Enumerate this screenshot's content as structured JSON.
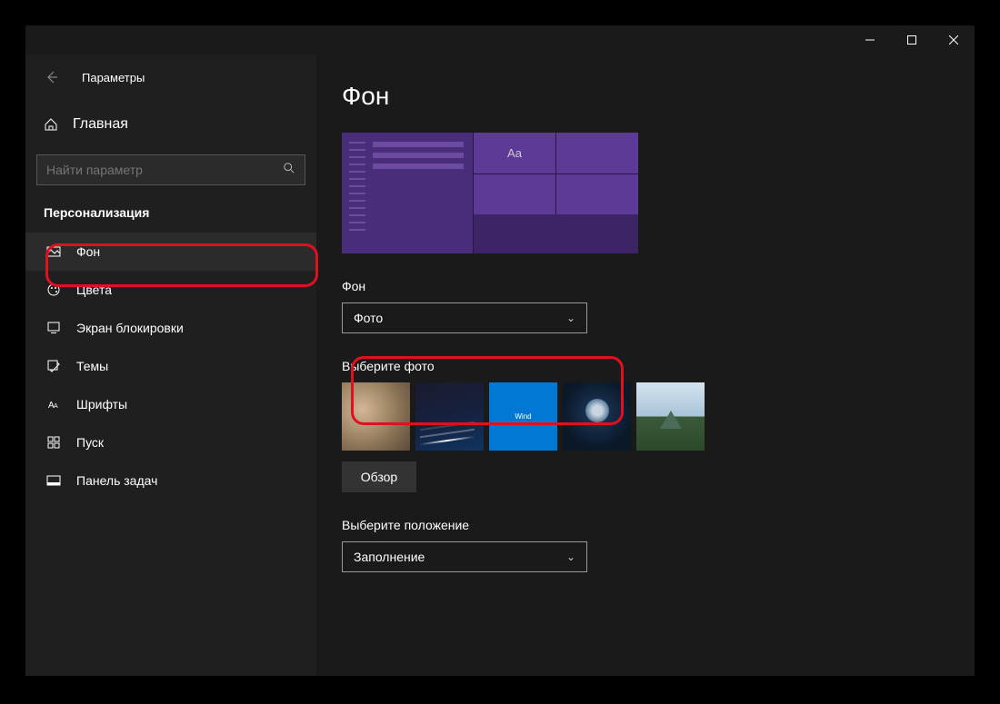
{
  "window": {
    "title": "Параметры"
  },
  "sidebar": {
    "home": "Главная",
    "search_placeholder": "Найти параметр",
    "category": "Персонализация",
    "items": [
      {
        "label": "Фон",
        "icon": "picture-icon",
        "active": true
      },
      {
        "label": "Цвета",
        "icon": "palette-icon",
        "active": false
      },
      {
        "label": "Экран блокировки",
        "icon": "lock-screen-icon",
        "active": false
      },
      {
        "label": "Темы",
        "icon": "themes-icon",
        "active": false
      },
      {
        "label": "Шрифты",
        "icon": "fonts-icon",
        "active": false
      },
      {
        "label": "Пуск",
        "icon": "start-icon",
        "active": false
      },
      {
        "label": "Панель задач",
        "icon": "taskbar-icon",
        "active": false
      }
    ]
  },
  "main": {
    "title": "Фон",
    "preview_sample_text": "Aa",
    "background_label": "Фон",
    "background_dropdown": "Фото",
    "choose_photo_label": "Выберите фото",
    "win_thumb_text": "Wind",
    "browse_button": "Обзор",
    "position_label": "Выберите положение",
    "position_dropdown": "Заполнение"
  }
}
